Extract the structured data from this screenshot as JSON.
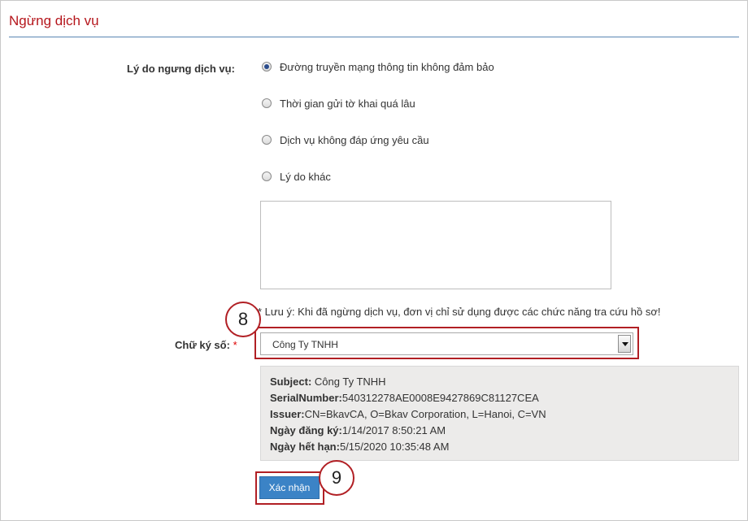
{
  "page": {
    "title": "Ngừng dịch vụ"
  },
  "reason": {
    "label": "Lý do ngưng dịch vụ:",
    "options": [
      {
        "label": "Đường truyền mạng thông tin không đảm bảo",
        "checked": true
      },
      {
        "label": "Thời gian gửi tờ khai quá lâu",
        "checked": false
      },
      {
        "label": "Dịch vụ không đáp ứng yêu cầu",
        "checked": false
      },
      {
        "label": "Lý do khác",
        "checked": false
      }
    ],
    "other_text": ""
  },
  "note": "* Lưu ý: Khi đã ngừng dịch vụ, đơn vị chỉ sử dụng được các chức năng tra cứu hồ sơ!",
  "signature": {
    "label": "Chữ ký số:",
    "required_mark": "*",
    "selected": "Công Ty TNHH"
  },
  "certificate": {
    "subject_label": "Subject:",
    "subject_value": " Công Ty TNHH",
    "serial_label": "SerialNumber:",
    "serial_value": "540312278AE0008E9427869C81127CEA",
    "issuer_label": "Issuer:",
    "issuer_value": "CN=BkavCA, O=Bkav Corporation, L=Hanoi, C=VN",
    "registered_label": "Ngày đăng ký:",
    "registered_value": "1/14/2017 8:50:21 AM",
    "expiry_label": "Ngày hết hạn:",
    "expiry_value": "5/15/2020 10:35:48 AM"
  },
  "actions": {
    "confirm_label": "Xác nhận"
  },
  "annotations": {
    "step_8": "8",
    "step_9": "9"
  },
  "colors": {
    "title": "#b5161c",
    "accent": "#3b83c6",
    "callout": "#b11f24"
  }
}
